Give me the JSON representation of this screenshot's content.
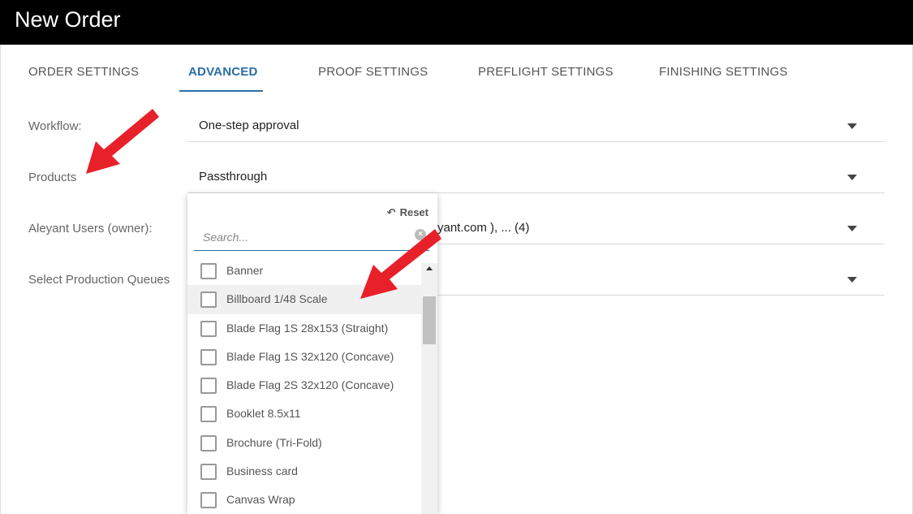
{
  "window": {
    "title": "New Order"
  },
  "tabs": [
    {
      "label": "ORDER SETTINGS"
    },
    {
      "label": "ADVANCED"
    },
    {
      "label": "PROOF SETTINGS"
    },
    {
      "label": "PREFLIGHT SETTINGS"
    },
    {
      "label": "FINISHING SETTINGS"
    }
  ],
  "active_tab": "ADVANCED",
  "fields": {
    "workflow": {
      "label": "Workflow:",
      "value": "One-step approval"
    },
    "products": {
      "label": "Products",
      "value": "Passthrough"
    },
    "users": {
      "label": "Aleyant Users (owner):",
      "value": "yant.com ), ... (4)"
    },
    "queues": {
      "label": "Select Production Queues",
      "value": ""
    }
  },
  "dropdown": {
    "reset_label": "Reset",
    "search_placeholder": "Search...",
    "items": [
      {
        "label": "Banner",
        "checked": false
      },
      {
        "label": "Billboard 1/48 Scale",
        "checked": false
      },
      {
        "label": "Blade Flag 1S 28x153 (Straight)",
        "checked": false
      },
      {
        "label": "Blade Flag 1S 32x120 (Concave)",
        "checked": false
      },
      {
        "label": "Blade Flag 2S 32x120 (Concave)",
        "checked": false
      },
      {
        "label": "Booklet 8.5x11",
        "checked": false
      },
      {
        "label": "Brochure (Tri-Fold)",
        "checked": false
      },
      {
        "label": "Business card",
        "checked": false
      },
      {
        "label": "Canvas Wrap",
        "checked": false
      }
    ]
  },
  "colors": {
    "accent": "#2a6ea8",
    "annotation_arrow": "#e8202a"
  }
}
